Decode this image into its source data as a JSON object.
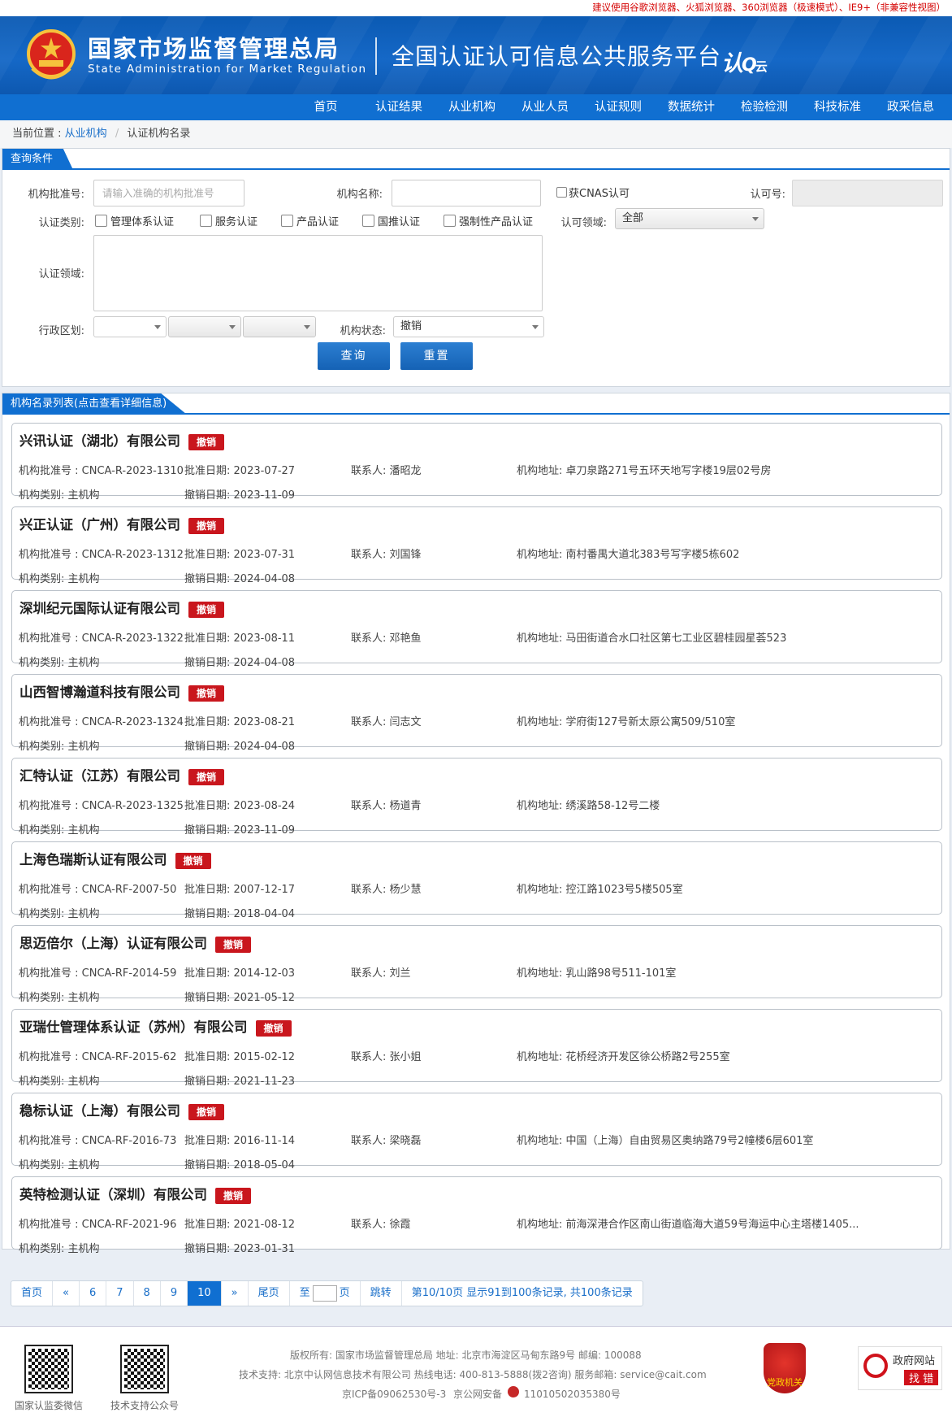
{
  "top_notice": "建议使用谷歌浏览器、火狐浏览器、360浏览器（极速模式）、IE9+（非兼容性视图）",
  "header": {
    "agency_cn": "国家市场监督管理总局",
    "agency_en": "State Administration  for  Market Regulation",
    "platform": "全国认证认可信息公共服务平台",
    "brand": "认",
    "brand_small": "云"
  },
  "nav": [
    "首页",
    "认证结果",
    "从业机构",
    "从业人员",
    "认证规则",
    "数据统计",
    "检验检测",
    "科技标准",
    "政采信息"
  ],
  "breadcrumb": {
    "prefix": "当前位置 :",
    "level1": "从业机构",
    "level2": "认证机构名录"
  },
  "query": {
    "title": "查询条件",
    "approval_no_label": "机构批准号:",
    "approval_no_placeholder": "请输入准确的机构批准号",
    "name_label": "机构名称:",
    "cnas_label": "获CNAS认可",
    "accred_no_label": "认可号:",
    "cert_type_label": "认证类别:",
    "cert_types": [
      "管理体系认证",
      "服务认证",
      "产品认证",
      "国推认证",
      "强制性产品认证"
    ],
    "accred_field_label": "认可领域:",
    "accred_field_value": "全部",
    "cert_field_label": "认证领域:",
    "region_label": "行政区划:",
    "status_label": "机构状态:",
    "status_value": "撤销",
    "search_btn": "查询",
    "reset_btn": "重置"
  },
  "list": {
    "title": "机构名录列表(点击查看详细信息)",
    "labels": {
      "no": "机构批准号 :",
      "date": "批准日期:",
      "contact": "联系人:",
      "address": "机构地址:",
      "type": "机构类别:",
      "revoke": "撤销日期:"
    },
    "records": [
      {
        "name": "兴讯认证（湖北）有限公司",
        "badge": "撤销",
        "no": "CNCA-R-2023-1310",
        "date": "2023-07-27",
        "contact": "潘昭龙",
        "address": "卓刀泉路271号五环天地写字楼19层02号房",
        "type": "主机构",
        "revoke": "2023-11-09"
      },
      {
        "name": "兴正认证（广州）有限公司",
        "badge": "撤销",
        "no": "CNCA-R-2023-1312",
        "date": "2023-07-31",
        "contact": "刘国锋",
        "address": "南村番禺大道北383号写字楼5栋602",
        "type": "主机构",
        "revoke": "2024-04-08"
      },
      {
        "name": "深圳纪元国际认证有限公司",
        "badge": "撤销",
        "no": "CNCA-R-2023-1322",
        "date": "2023-08-11",
        "contact": "邓艳鱼",
        "address": "马田街道合水口社区第七工业区碧桂园星荟523",
        "type": "主机构",
        "revoke": "2024-04-08"
      },
      {
        "name": "山西智博瀚道科技有限公司",
        "badge": "撤销",
        "no": "CNCA-R-2023-1324",
        "date": "2023-08-21",
        "contact": "闫志文",
        "address": "学府街127号新太原公寓509/510室",
        "type": "主机构",
        "revoke": "2024-04-08"
      },
      {
        "name": "汇特认证（江苏）有限公司",
        "badge": "撤销",
        "no": "CNCA-R-2023-1325",
        "date": "2023-08-24",
        "contact": "杨道青",
        "address": "绣溪路58-12号二楼",
        "type": "主机构",
        "revoke": "2023-11-09"
      },
      {
        "name": "上海色瑞斯认证有限公司",
        "badge": "撤销",
        "no": "CNCA-RF-2007-50",
        "date": "2007-12-17",
        "contact": "杨少慧",
        "address": "控江路1023号5楼505室",
        "type": "主机构",
        "revoke": "2018-04-04"
      },
      {
        "name": "思迈倍尔（上海）认证有限公司",
        "badge": "撤销",
        "no": "CNCA-RF-2014-59",
        "date": "2014-12-03",
        "contact": "刘兰",
        "address": "乳山路98号511-101室",
        "type": "主机构",
        "revoke": "2021-05-12"
      },
      {
        "name": "亚瑞仕管理体系认证（苏州）有限公司",
        "badge": "撤销",
        "no": "CNCA-RF-2015-62",
        "date": "2015-02-12",
        "contact": "张小姐",
        "address": "花桥经济开发区徐公桥路2号255室",
        "type": "主机构",
        "revoke": "2021-11-23"
      },
      {
        "name": "稳标认证（上海）有限公司",
        "badge": "撤销",
        "no": "CNCA-RF-2016-73",
        "date": "2016-11-14",
        "contact": "梁晓磊",
        "address": "中国（上海）自由贸易区奥纳路79号2幢楼6层601室",
        "type": "主机构",
        "revoke": "2018-05-04"
      },
      {
        "name": "英特检测认证（深圳）有限公司",
        "badge": "撤销",
        "no": "CNCA-RF-2021-96",
        "date": "2021-08-12",
        "contact": "徐霞",
        "address": "前海深港合作区南山街道临海大道59号海运中心主塔楼1405...",
        "type": "主机构",
        "revoke": "2023-01-31"
      }
    ]
  },
  "pager": {
    "first": "首页",
    "prev": "«",
    "pages": [
      "6",
      "7",
      "8",
      "9",
      "10"
    ],
    "current": "10",
    "next": "»",
    "last": "尾页",
    "to": "至",
    "page_unit": "页",
    "jump": "跳转",
    "summary": "第10/10页  显示91到100条记录, 共100条记录"
  },
  "footer": {
    "qr1_label": "国家认监委微信",
    "qr2_label": "技术支持公众号",
    "line1": "版权所有:  国家市场监督管理总局     地址:  北京市海淀区马甸东路9号     邮编:  100088",
    "line2": "技术支持:  北京中认网信息技术有限公司     热线电话:  400-813-5888(拨2咨询)     服务邮箱:  service@cait.com",
    "icp": "京ICP备09062530号-3",
    "police": "京公网安备",
    "police_no": "11010502035380号",
    "party_label": "党政机关",
    "gov_line1": "政府网站",
    "gov_line2": "找 错"
  },
  "colors": {
    "primary": "#106fd1",
    "badge": "#c9161d",
    "notice": "#d40000"
  }
}
